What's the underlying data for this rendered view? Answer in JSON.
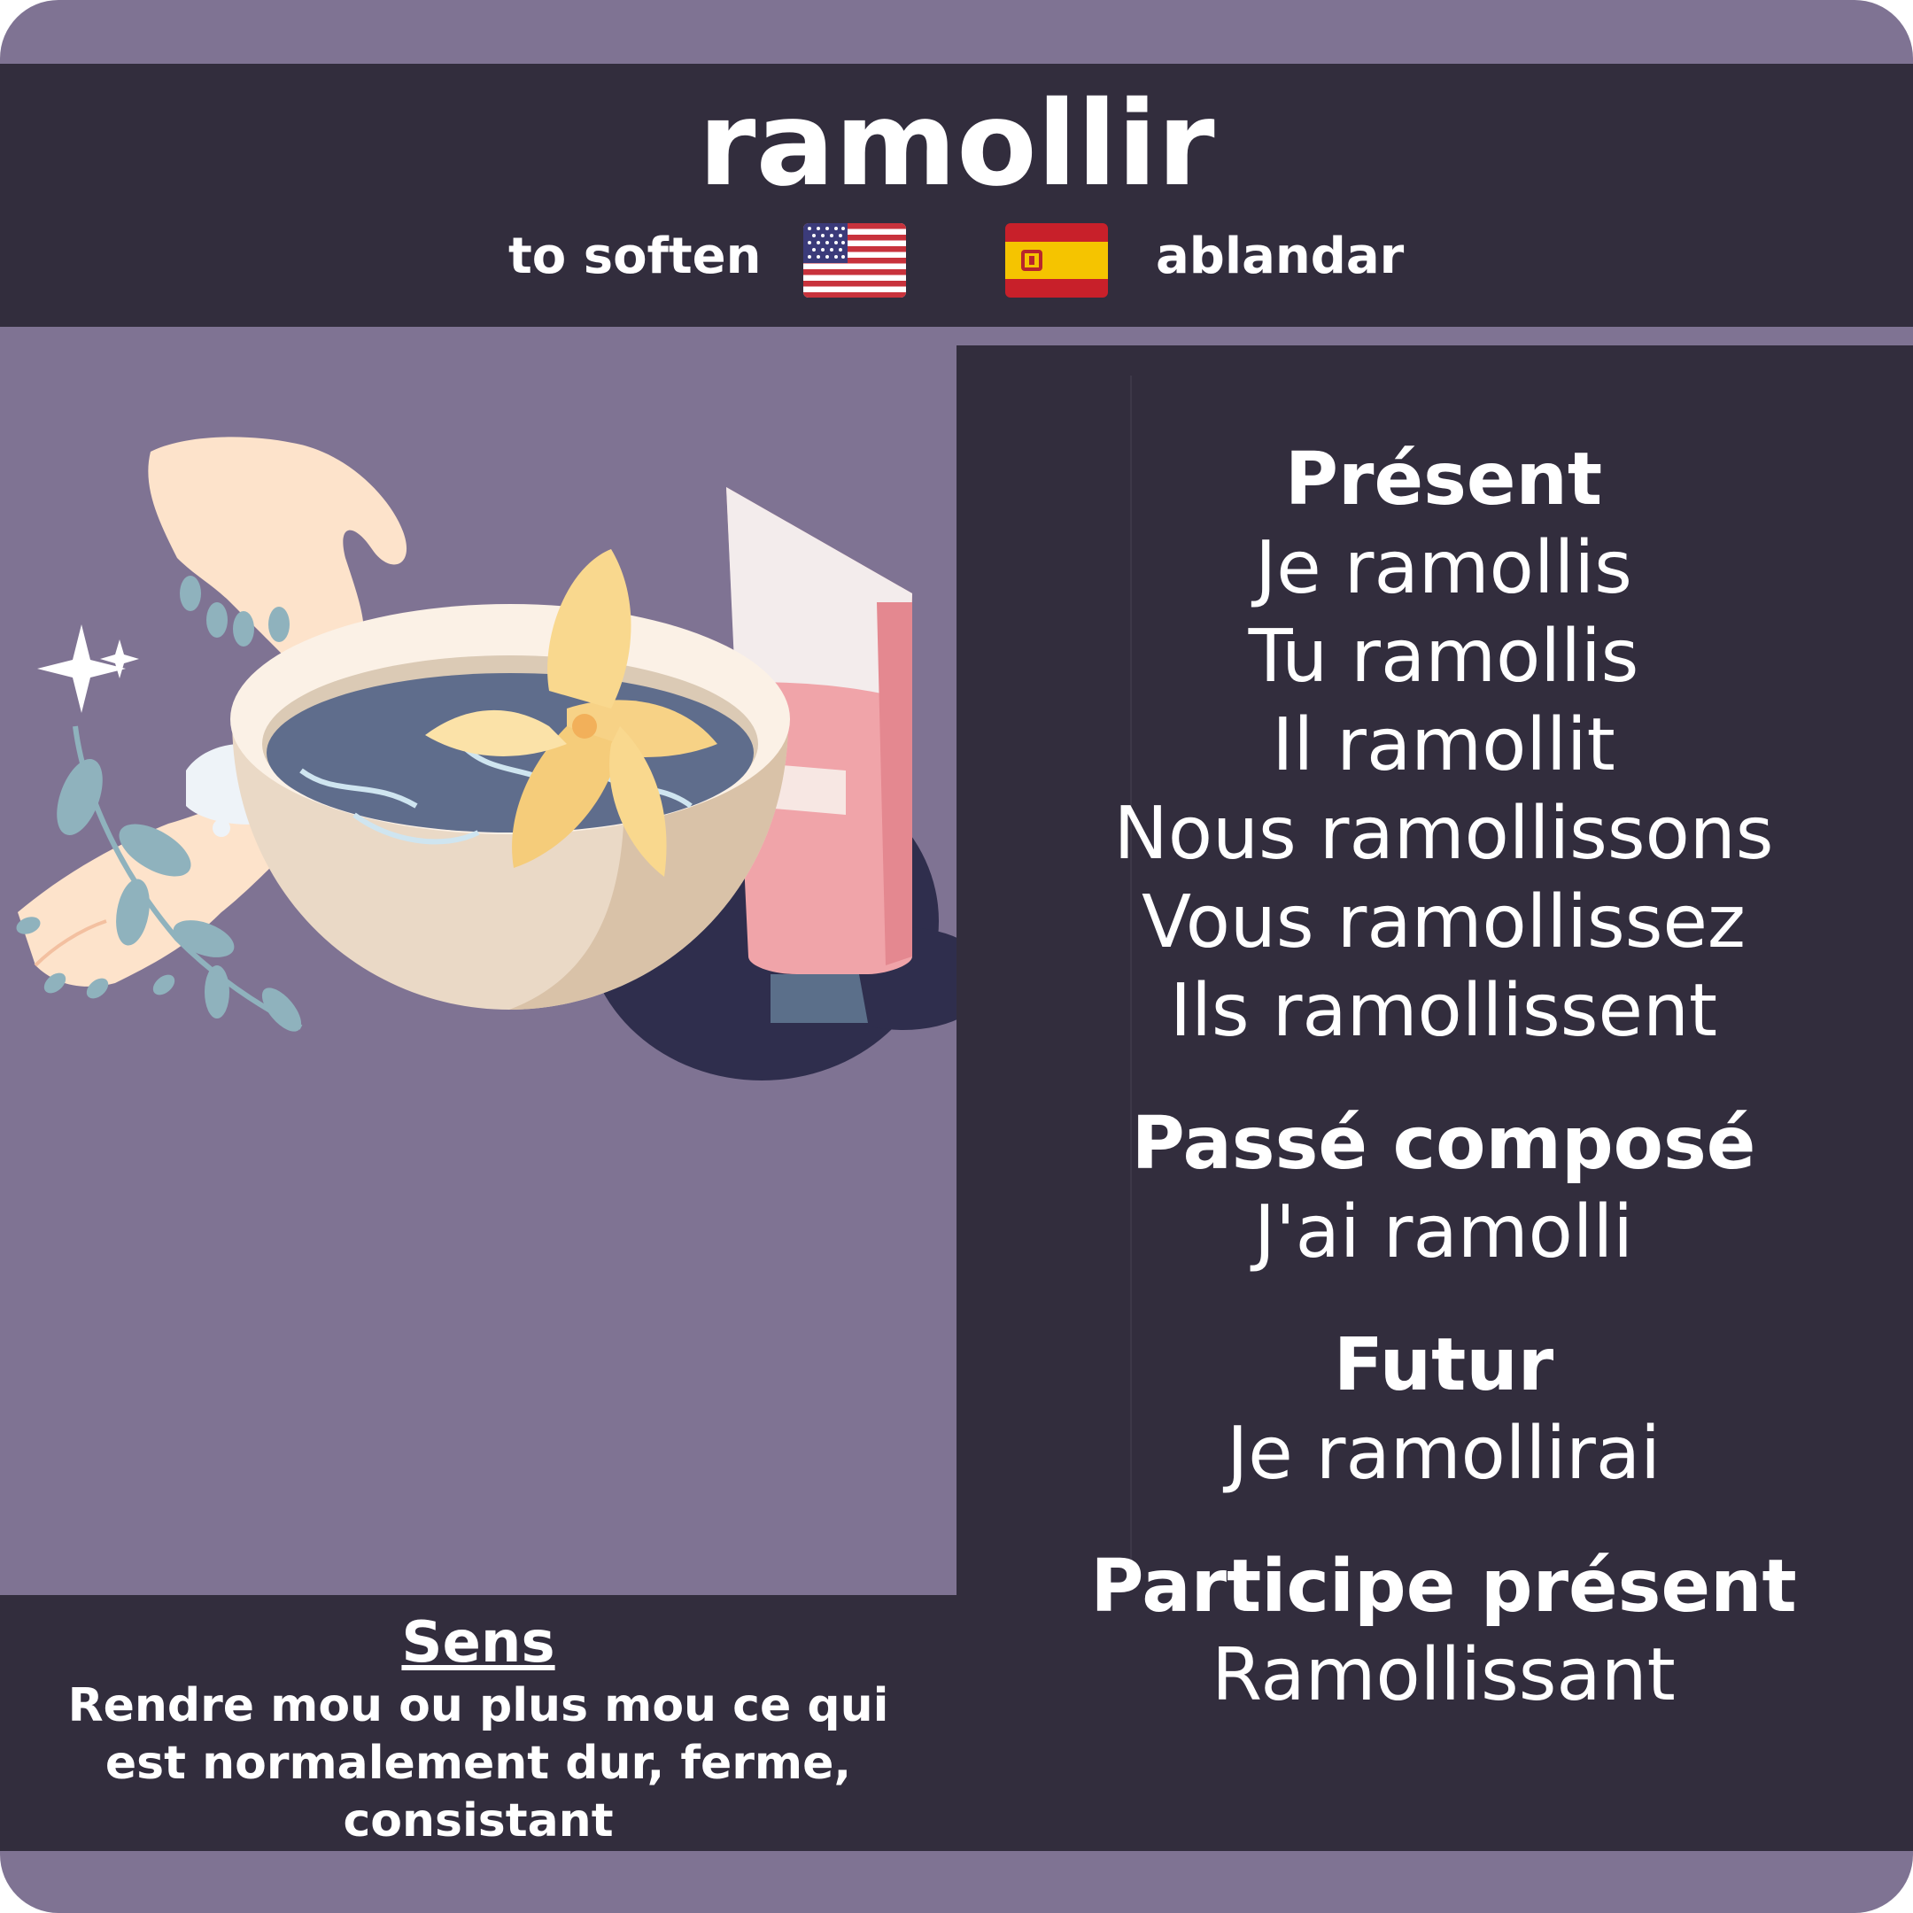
{
  "verb": "ramollir",
  "translations": {
    "english": "to soften",
    "spanish": "ablandar"
  },
  "conjugation": {
    "present": {
      "label": "Présent",
      "forms": [
        "Je ramollis",
        "Tu ramollis",
        "Il ramollit",
        "Nous ramollissons",
        "Vous ramollissez",
        "Ils ramollissent"
      ]
    },
    "passe_compose": {
      "label": "Passé composé",
      "form": "J'ai ramolli"
    },
    "futur": {
      "label": "Futur",
      "form": "Je ramollirai"
    },
    "participe_present": {
      "label": "Participe présent",
      "form": "Ramollissant"
    }
  },
  "meaning": {
    "label": "Sens",
    "text": "Rendre mou ou plus mou ce qui est normalement dur, ferme, consistant"
  },
  "icons": [
    "us-flag-icon",
    "spain-flag-icon"
  ],
  "colors": {
    "background": "#7f7393",
    "panel": "#322d3d",
    "text": "#ffffff"
  }
}
